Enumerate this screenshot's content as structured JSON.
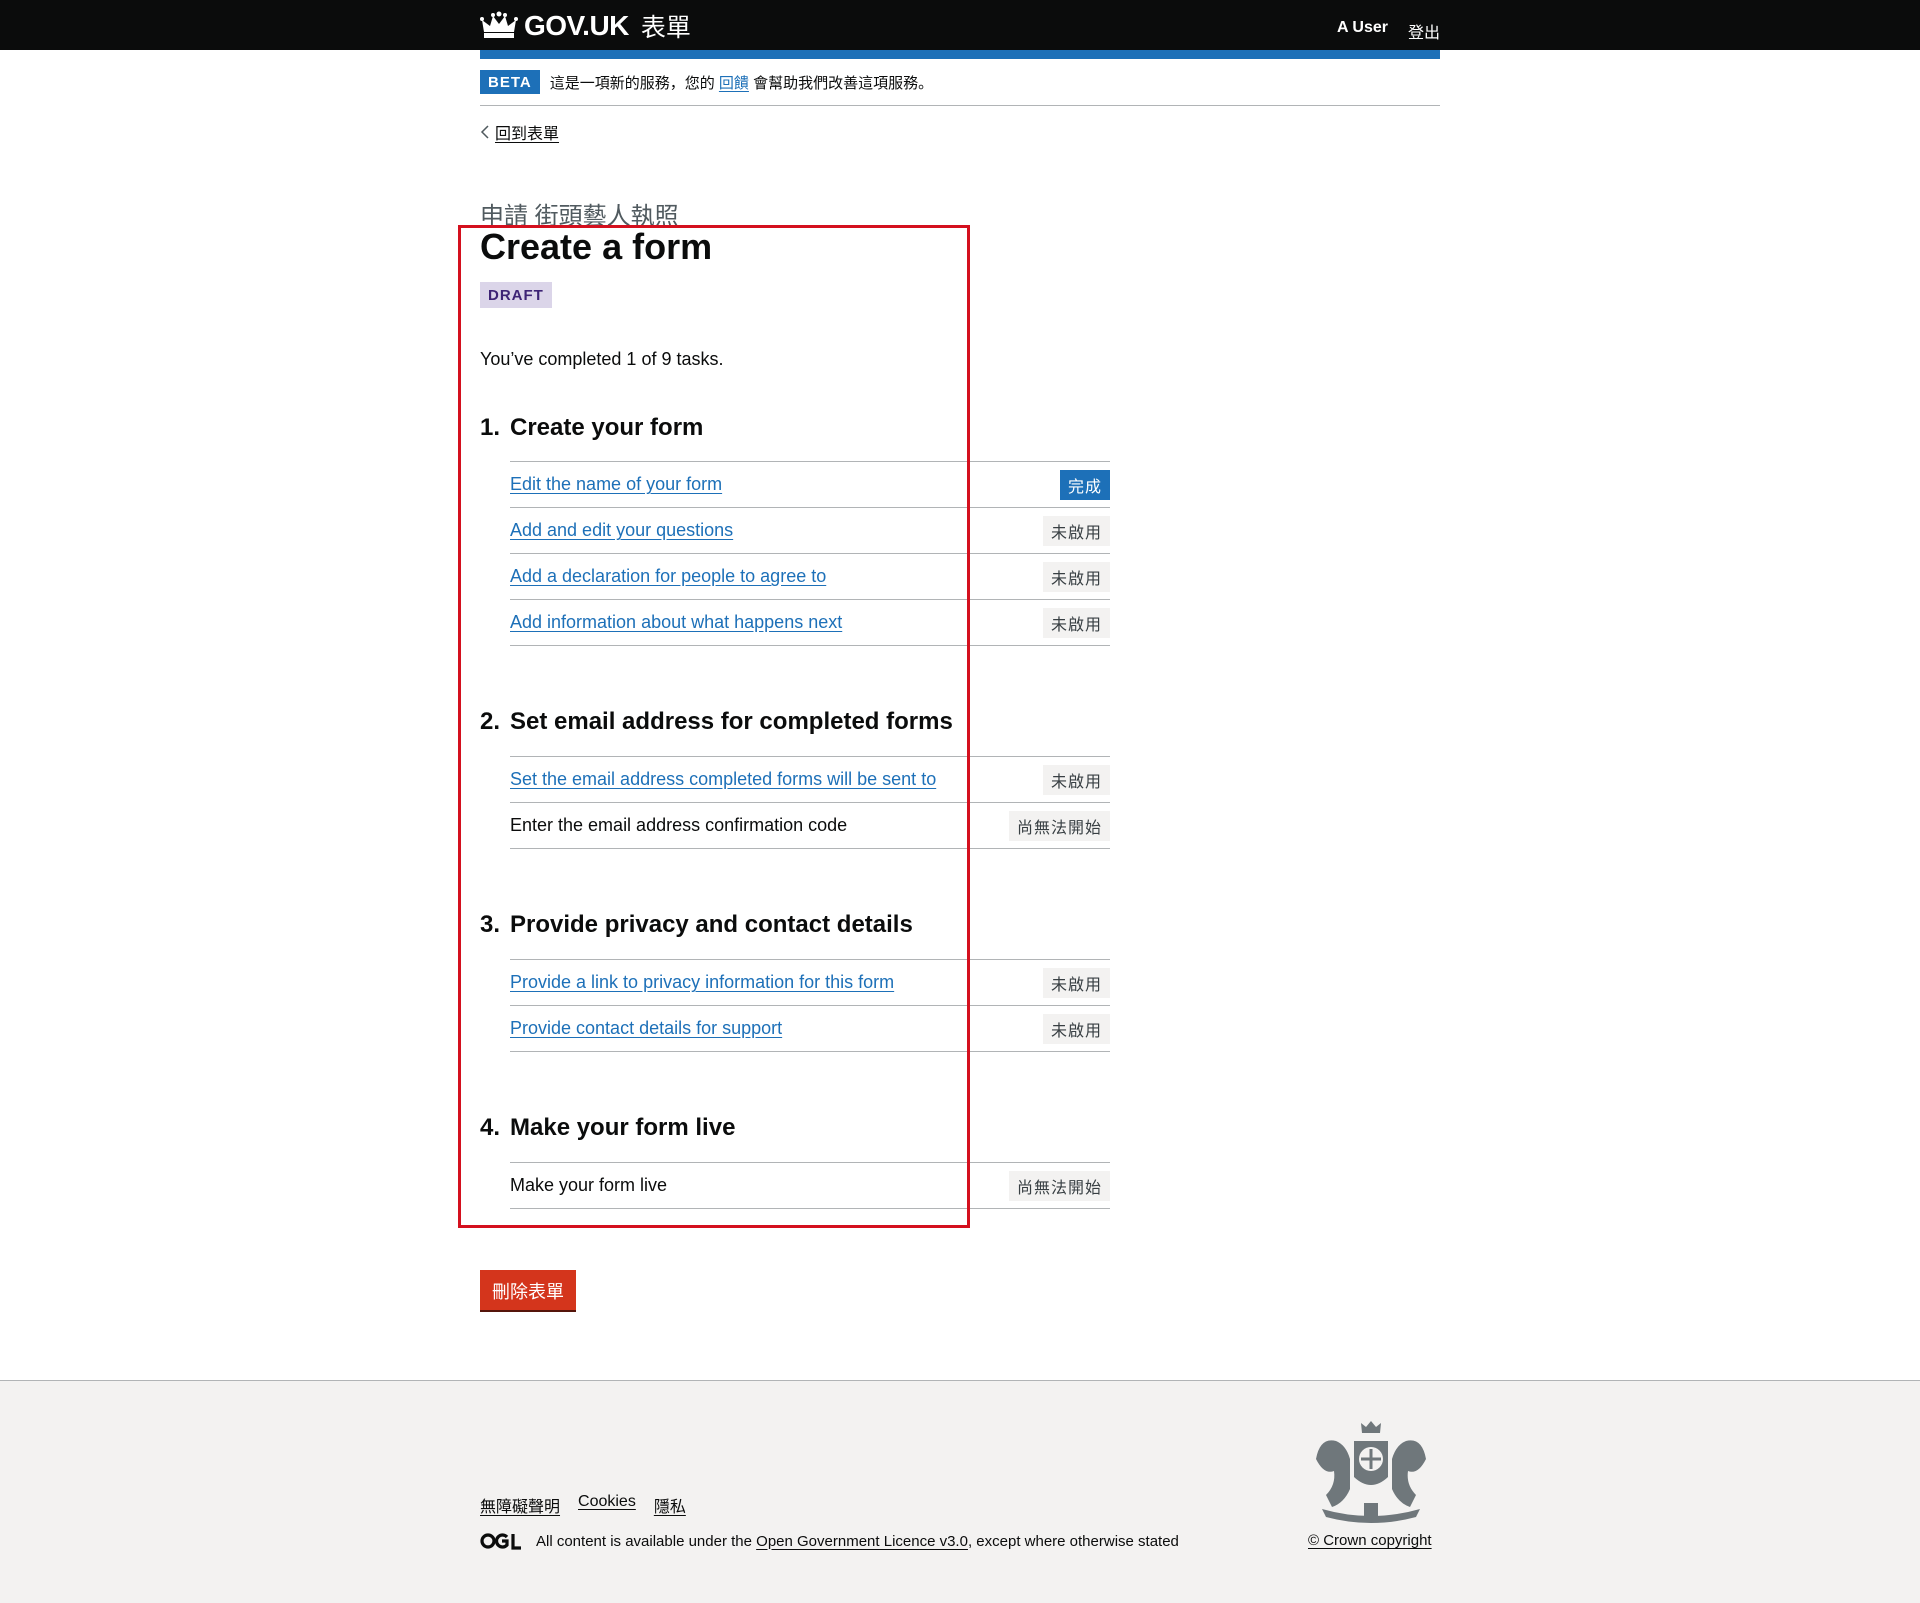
{
  "header": {
    "logo_text": "GOV.UK",
    "service_name": "表單",
    "user_name": "A User",
    "sign_out": "登出"
  },
  "phase_banner": {
    "tag": "BETA",
    "text_before": "這是一項新的服務，您的",
    "feedback_link": "回饋",
    "text_after": "會幫助我們改善這項服務。"
  },
  "back_link": "回到表單",
  "caption": "申請 街頭藝人執照",
  "title": "Create a form",
  "draft_tag": "DRAFT",
  "progress_text": "You’ve completed 1 of 9 tasks.",
  "sections": [
    {
      "number": "1.",
      "title": "Create your form",
      "tasks": [
        {
          "label": "Edit the name of your form",
          "status": "完成"
        },
        {
          "label": "Add and edit your questions",
          "status": "未啟用"
        },
        {
          "label": "Add a declaration for people to agree to",
          "status": "未啟用"
        },
        {
          "label": "Add information about what happens next",
          "status": "未啟用"
        }
      ]
    },
    {
      "number": "2.",
      "title": "Set email address for completed forms",
      "tasks": [
        {
          "label": "Set the email address completed forms will be sent to",
          "status": "未啟用"
        },
        {
          "label": "Enter the email address confirmation code",
          "status": "尚無法開始"
        }
      ]
    },
    {
      "number": "3.",
      "title": "Provide privacy and contact details",
      "tasks": [
        {
          "label": "Provide a link to privacy information for this form",
          "status": "未啟用"
        },
        {
          "label": "Provide contact details for support",
          "status": "未啟用"
        }
      ]
    },
    {
      "number": "4.",
      "title": "Make your form live",
      "tasks": [
        {
          "label": "Make your form live",
          "status": "尚無法開始"
        }
      ]
    }
  ],
  "delete_button": "刪除表單",
  "footer": {
    "links": [
      "無障礙聲明",
      "Cookies",
      "隱私"
    ],
    "licence_before": "All content is available under the",
    "licence_link": "Open Government Licence v3.0",
    "licence_after": ", except where otherwise stated",
    "copyright": "© Crown copyright"
  },
  "icons": {
    "crown": "crown-icon",
    "back": "chevron-left-icon",
    "ogl": "ogl-logo-icon",
    "crest": "royal-coat-of-arms-icon"
  },
  "colors": {
    "header_bg": "#0b0c0c",
    "brand_blue": "#1d70b8",
    "draft_bg": "#dbd5e9",
    "draft_text": "#3d2375",
    "delete_red": "#d4351c",
    "highlight_red": "#d4101e",
    "footer_bg": "#f3f2f1"
  }
}
